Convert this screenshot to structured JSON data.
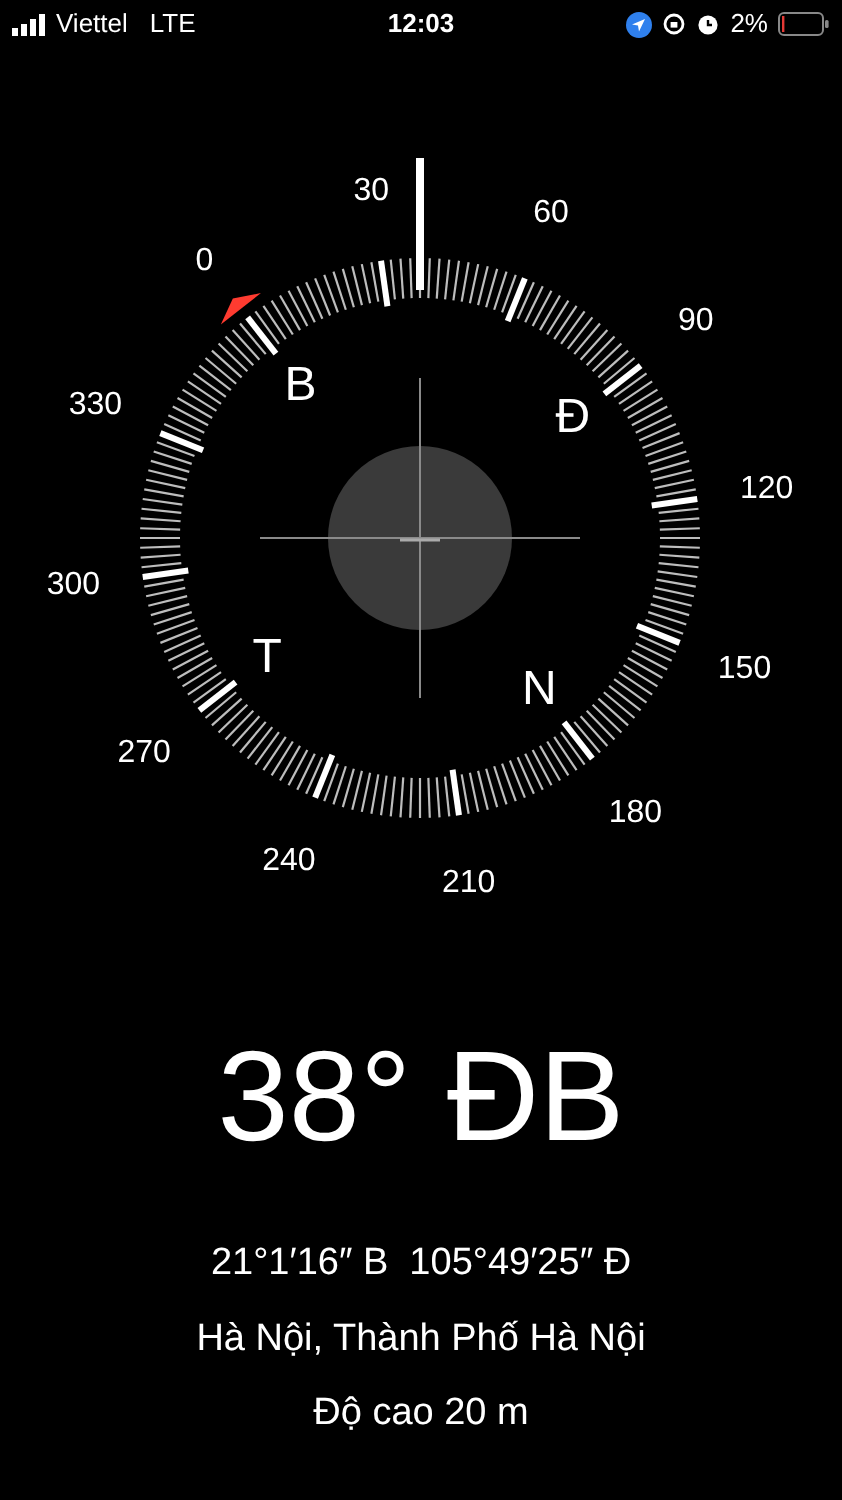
{
  "status_bar": {
    "carrier": "Viettel",
    "network": "LTE",
    "time": "12:03",
    "battery": "2%"
  },
  "compass": {
    "dial_labels": [
      "0",
      "30",
      "60",
      "90",
      "120",
      "150",
      "180",
      "210",
      "240",
      "270",
      "300",
      "330"
    ],
    "cardinals": [
      "B",
      "Đ",
      "N",
      "T"
    ]
  },
  "readout": {
    "heading": "38° ĐB",
    "coordinates": "21°1′16″ B  105°49′25″ Đ",
    "location": "Hà Nội, Thành Phố Hà Nội",
    "altitude": "Độ cao 20 m"
  }
}
